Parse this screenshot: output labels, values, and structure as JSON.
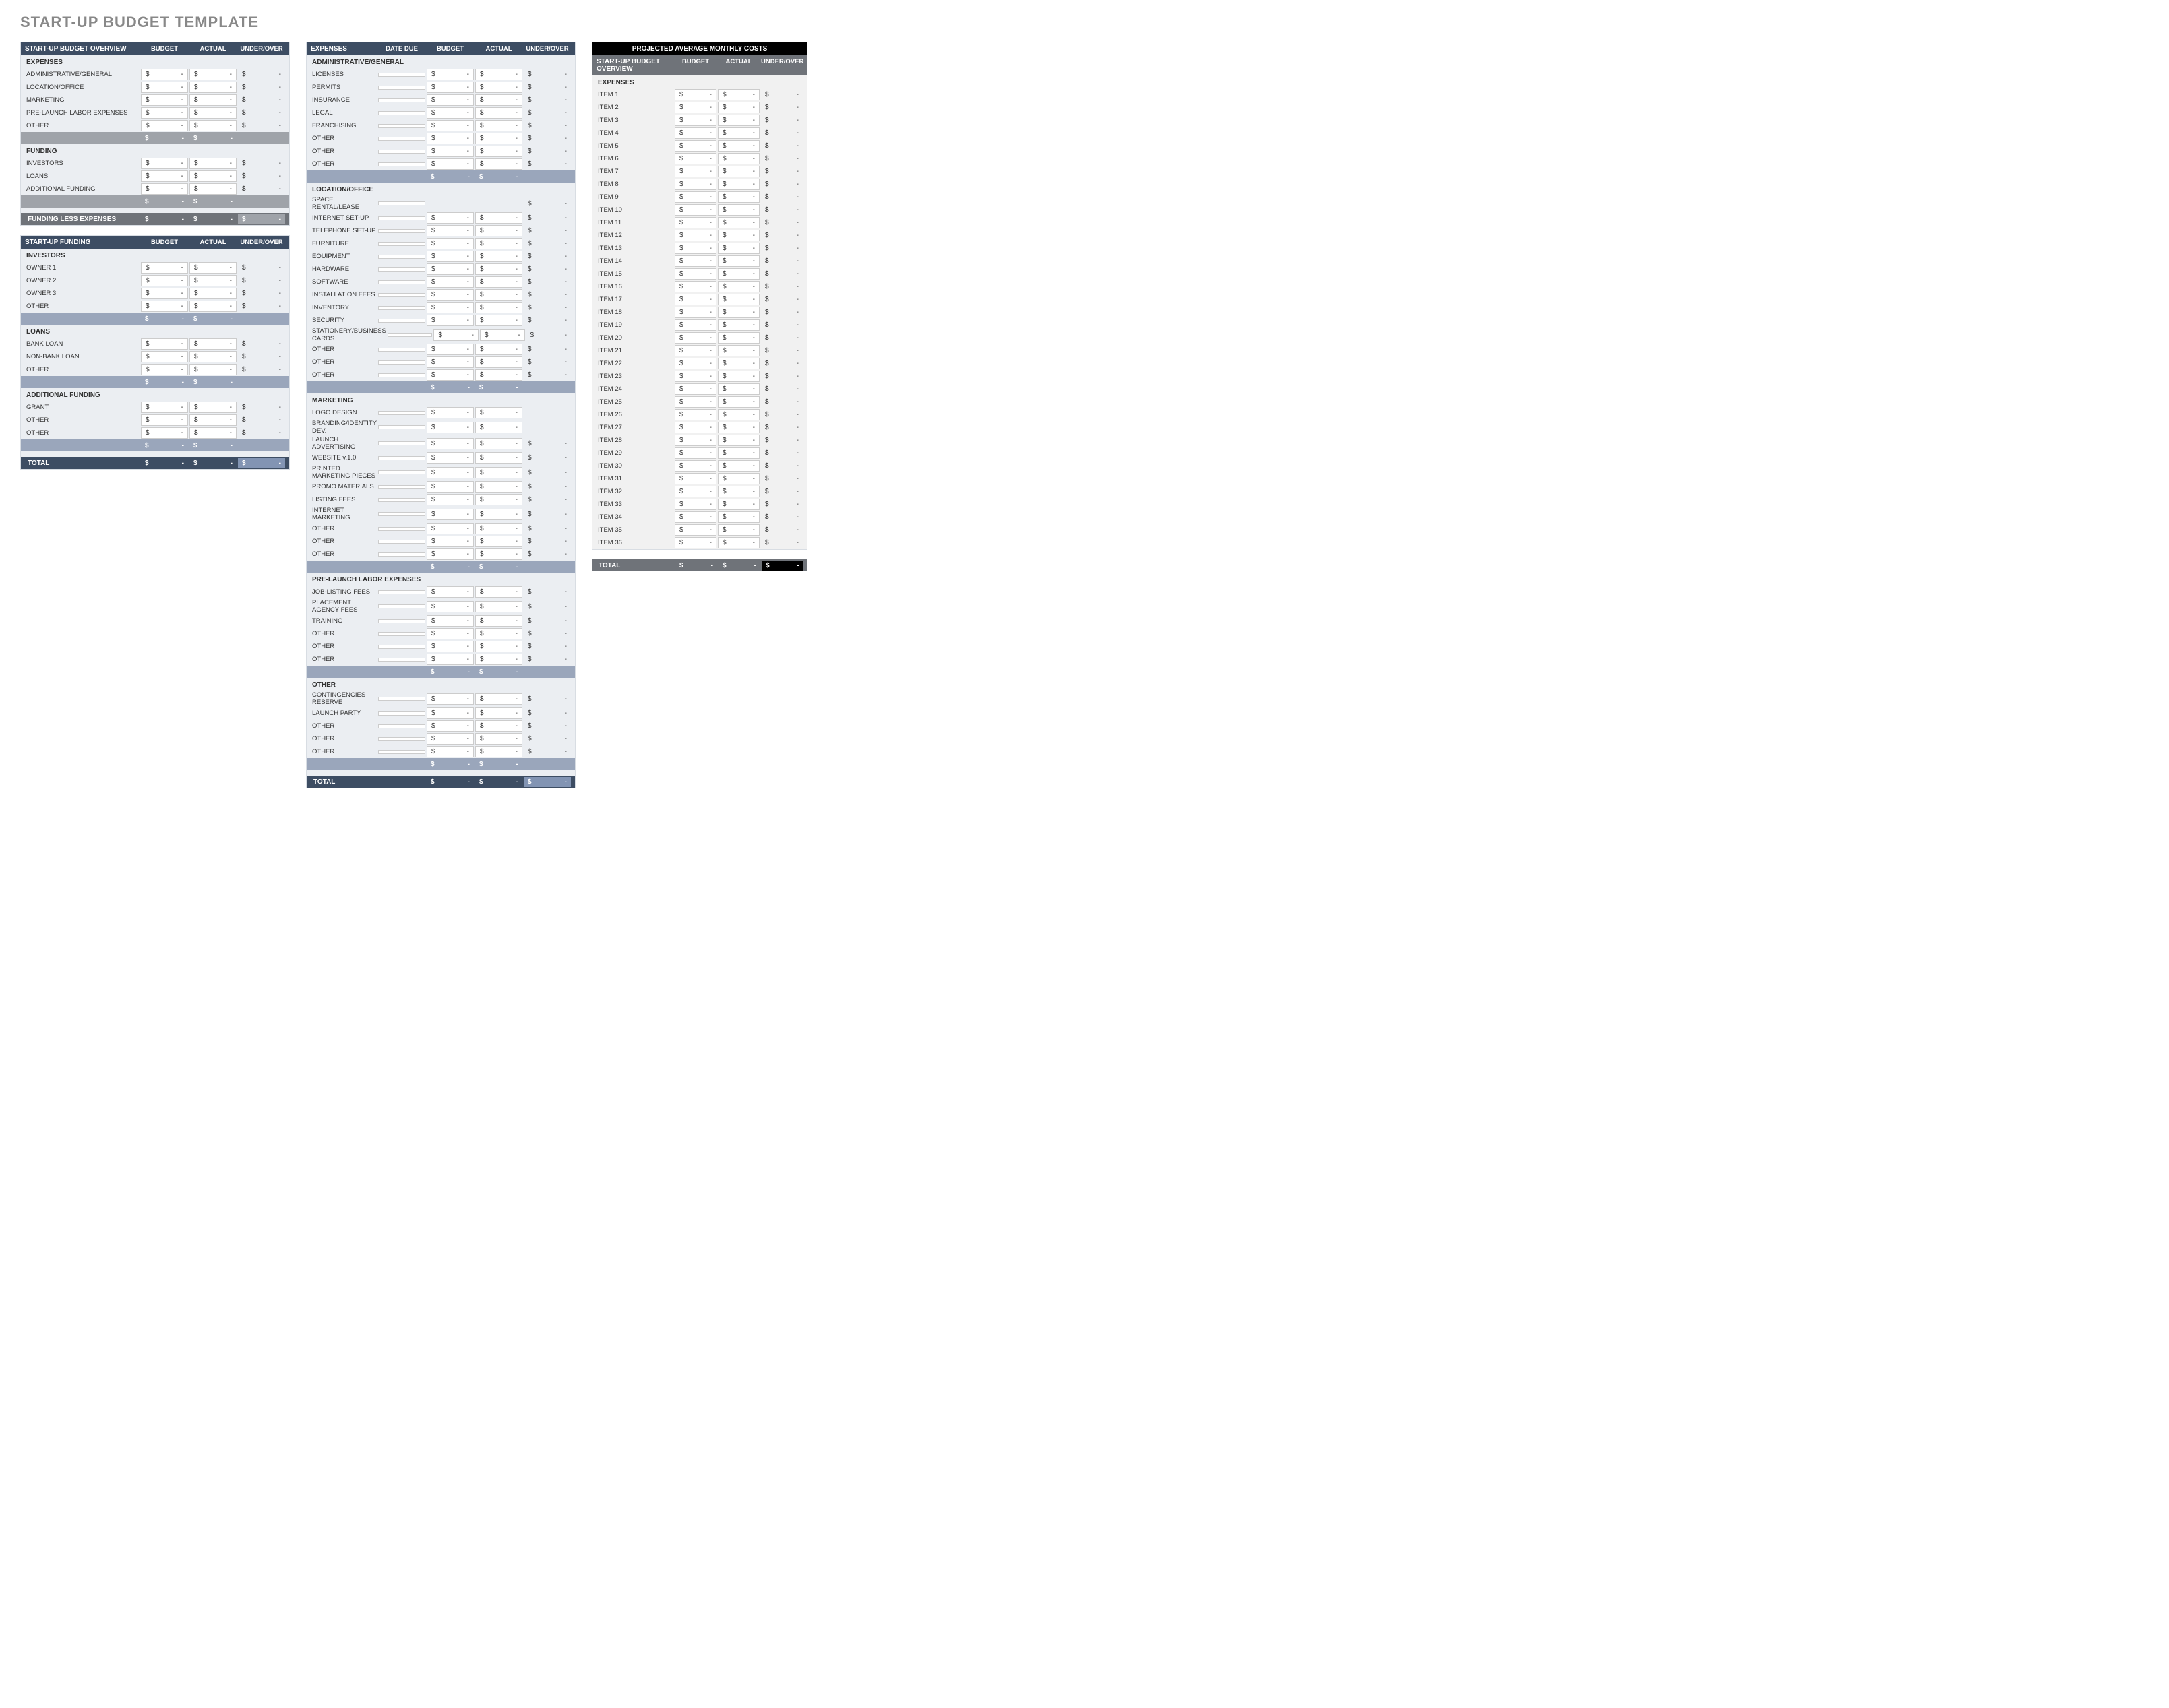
{
  "title": "START-UP BUDGET TEMPLATE",
  "headers": {
    "budget": "BUDGET",
    "actual": "ACTUAL",
    "under_over": "UNDER/OVER",
    "date_due": "DATE DUE"
  },
  "currency": "$",
  "dash": "-",
  "overview": {
    "title": "START-UP BUDGET OVERVIEW",
    "expenses_label": "EXPENSES",
    "expenses": [
      "ADMINISTRATIVE/GENERAL",
      "LOCATION/OFFICE",
      "MARKETING",
      "PRE-LAUNCH LABOR EXPENSES",
      "OTHER"
    ],
    "funding_label": "FUNDING",
    "funding": [
      "INVESTORS",
      "LOANS",
      "ADDITIONAL FUNDING"
    ],
    "funding_less_expenses": "FUNDING LESS EXPENSES"
  },
  "startup_funding": {
    "title": "START-UP FUNDING",
    "sections": [
      {
        "label": "INVESTORS",
        "items": [
          "OWNER 1",
          "OWNER 2",
          "OWNER 3",
          "OTHER"
        ]
      },
      {
        "label": "LOANS",
        "items": [
          "BANK LOAN",
          "NON-BANK LOAN",
          "OTHER"
        ]
      },
      {
        "label": "ADDITIONAL FUNDING",
        "items": [
          "GRANT",
          "OTHER",
          "OTHER"
        ]
      }
    ],
    "total": "TOTAL"
  },
  "expenses": {
    "title": "EXPENSES",
    "sections": [
      {
        "label": "ADMINISTRATIVE/GENERAL",
        "items": [
          "LICENSES",
          "PERMITS",
          "INSURANCE",
          "LEGAL",
          "FRANCHISING",
          "OTHER",
          "OTHER",
          "OTHER"
        ]
      },
      {
        "label": "LOCATION/OFFICE",
        "first_no_vals": true,
        "items": [
          "SPACE RENTAL/LEASE",
          "INTERNET SET-UP",
          "TELEPHONE SET-UP",
          "FURNITURE",
          "EQUIPMENT",
          "HARDWARE",
          "SOFTWARE",
          "INSTALLATION FEES",
          "INVENTORY",
          "SECURITY",
          "STATIONERY/BUSINESS CARDS",
          "OTHER",
          "OTHER",
          "OTHER"
        ]
      },
      {
        "label": "MARKETING",
        "no_uo": [
          0,
          1
        ],
        "items": [
          "LOGO DESIGN",
          "BRANDING/IDENTITY DEV.",
          "LAUNCH ADVERTISING",
          "WEBSITE v.1.0",
          "PRINTED MARKETING PIECES",
          "PROMO MATERIALS",
          "LISTING FEES",
          "INTERNET MARKETING",
          "OTHER",
          "OTHER",
          "OTHER"
        ]
      },
      {
        "label": "PRE-LAUNCH LABOR EXPENSES",
        "items": [
          "JOB-LISTING FEES",
          "PLACEMENT AGENCY FEES",
          "TRAINING",
          "OTHER",
          "OTHER",
          "OTHER"
        ]
      },
      {
        "label": "OTHER",
        "items": [
          "CONTINGENCIES RESERVE",
          "LAUNCH PARTY",
          "OTHER",
          "OTHER",
          "OTHER"
        ]
      }
    ],
    "total": "TOTAL"
  },
  "monthly": {
    "title": "PROJECTED AVERAGE MONTHLY COSTS",
    "subtitle": "START-UP BUDGET OVERVIEW",
    "expenses_label": "EXPENSES",
    "items": [
      "ITEM 1",
      "ITEM 2",
      "ITEM 3",
      "ITEM 4",
      "ITEM 5",
      "ITEM 6",
      "ITEM 7",
      "ITEM 8",
      "ITEM 9",
      "ITEM 10",
      "ITEM 11",
      "ITEM 12",
      "ITEM 13",
      "ITEM 14",
      "ITEM 15",
      "ITEM 16",
      "ITEM 17",
      "ITEM 18",
      "ITEM 19",
      "ITEM 20",
      "ITEM 21",
      "ITEM 22",
      "ITEM 23",
      "ITEM 24",
      "ITEM 25",
      "ITEM 26",
      "ITEM 27",
      "ITEM 28",
      "ITEM 29",
      "ITEM 30",
      "ITEM 31",
      "ITEM 32",
      "ITEM 33",
      "ITEM 34",
      "ITEM 35",
      "ITEM 36"
    ],
    "total": "TOTAL"
  }
}
